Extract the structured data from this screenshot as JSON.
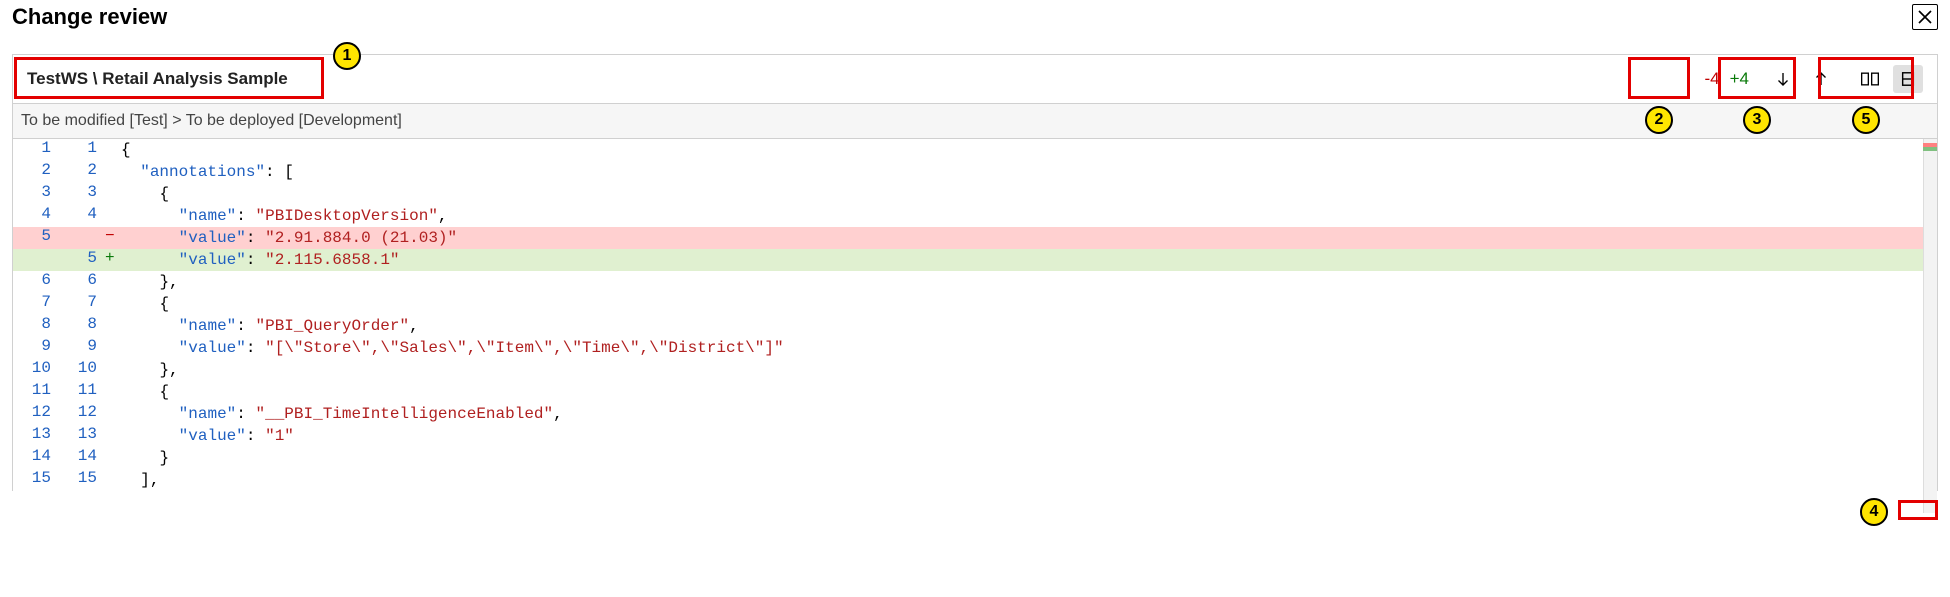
{
  "title": "Change review",
  "breadcrumb": "TestWS \\ Retail Analysis Sample",
  "diff_counts": {
    "deleted": "-4",
    "added": "+4"
  },
  "subheader": "To be modified [Test] > To be deployed [Development]",
  "badges": [
    "1",
    "2",
    "3",
    "4",
    "5"
  ],
  "chart_data": {
    "type": "table",
    "description": "Unified diff of JSON configuration — left gutter shows original/new line numbers; rows with only left number are deletions (red), rows with only right number are additions (green).",
    "columns": [
      "left_line",
      "right_line",
      "marker",
      "code"
    ],
    "rows": [
      {
        "left_line": "1",
        "right_line": "1",
        "marker": "",
        "code": "{"
      },
      {
        "left_line": "2",
        "right_line": "2",
        "marker": "",
        "code": "  \"annotations\": ["
      },
      {
        "left_line": "3",
        "right_line": "3",
        "marker": "",
        "code": "    {"
      },
      {
        "left_line": "4",
        "right_line": "4",
        "marker": "",
        "code": "      \"name\": \"PBIDesktopVersion\","
      },
      {
        "left_line": "5",
        "right_line": "",
        "marker": "-",
        "code": "      \"value\": \"2.91.884.0 (21.03)\""
      },
      {
        "left_line": "",
        "right_line": "5",
        "marker": "+",
        "code": "      \"value\": \"2.115.6858.1\""
      },
      {
        "left_line": "6",
        "right_line": "6",
        "marker": "",
        "code": "    },"
      },
      {
        "left_line": "7",
        "right_line": "7",
        "marker": "",
        "code": "    {"
      },
      {
        "left_line": "8",
        "right_line": "8",
        "marker": "",
        "code": "      \"name\": \"PBI_QueryOrder\","
      },
      {
        "left_line": "9",
        "right_line": "9",
        "marker": "",
        "code": "      \"value\": \"[\\\"Store\\\",\\\"Sales\\\",\\\"Item\\\",\\\"Time\\\",\\\"District\\\"]\""
      },
      {
        "left_line": "10",
        "right_line": "10",
        "marker": "",
        "code": "    },"
      },
      {
        "left_line": "11",
        "right_line": "11",
        "marker": "",
        "code": "    {"
      },
      {
        "left_line": "12",
        "right_line": "12",
        "marker": "",
        "code": "      \"name\": \"__PBI_TimeIntelligenceEnabled\","
      },
      {
        "left_line": "13",
        "right_line": "13",
        "marker": "",
        "code": "      \"value\": \"1\""
      },
      {
        "left_line": "14",
        "right_line": "14",
        "marker": "",
        "code": "    }"
      },
      {
        "left_line": "15",
        "right_line": "15",
        "marker": "",
        "code": "  ],"
      }
    ]
  }
}
